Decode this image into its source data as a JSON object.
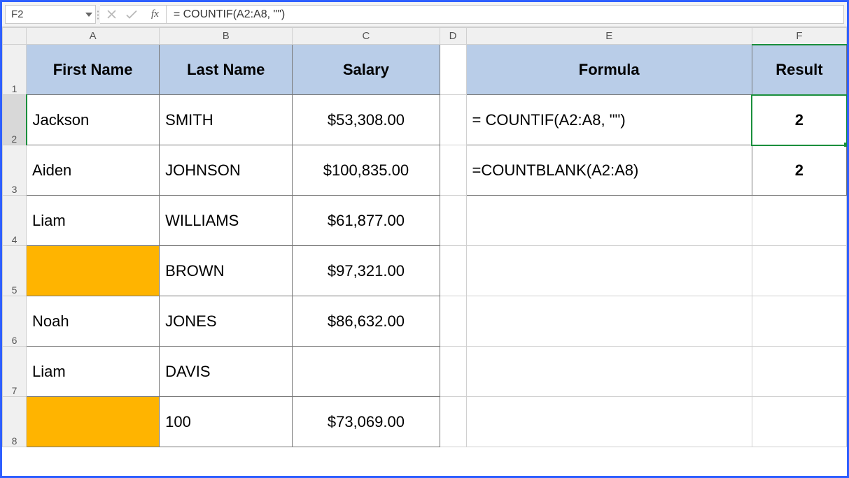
{
  "formula_bar": {
    "name_box": "F2",
    "fx_label": "fx",
    "formula": "= COUNTIF(A2:A8, \"\")"
  },
  "columns": [
    "A",
    "B",
    "C",
    "D",
    "E",
    "F"
  ],
  "row_numbers": [
    "1",
    "2",
    "3",
    "4",
    "5",
    "6",
    "7",
    "8"
  ],
  "selected_cell_ref": "F2",
  "headers": {
    "A": "First Name",
    "B": "Last Name",
    "C": "Salary",
    "E": "Formula",
    "F": "Result"
  },
  "data_rows": [
    {
      "first": "Jackson",
      "last": "SMITH",
      "salary": "$53,308.00",
      "first_blank_hl": false
    },
    {
      "first": "Aiden",
      "last": "JOHNSON",
      "salary": "$100,835.00",
      "first_blank_hl": false
    },
    {
      "first": "Liam",
      "last": "WILLIAMS",
      "salary": "$61,877.00",
      "first_blank_hl": false
    },
    {
      "first": "",
      "last": "BROWN",
      "salary": "$97,321.00",
      "first_blank_hl": true
    },
    {
      "first": "Noah",
      "last": "JONES",
      "salary": "$86,632.00",
      "first_blank_hl": false
    },
    {
      "first": "Liam",
      "last": "DAVIS",
      "salary": "",
      "first_blank_hl": false
    },
    {
      "first": "",
      "last": "100",
      "salary": "$73,069.00",
      "first_blank_hl": true
    }
  ],
  "side_rows": [
    {
      "formula": "= COUNTIF(A2:A8, \"\")",
      "result": "2"
    },
    {
      "formula": "=COUNTBLANK(A2:A8)",
      "result": "2"
    }
  ],
  "chart_data": {
    "type": "table",
    "title": "",
    "columns": [
      "First Name",
      "Last Name",
      "Salary"
    ],
    "rows": [
      [
        "Jackson",
        "SMITH",
        53308.0
      ],
      [
        "Aiden",
        "JOHNSON",
        100835.0
      ],
      [
        "Liam",
        "WILLIAMS",
        61877.0
      ],
      [
        "",
        "BROWN",
        97321.0
      ],
      [
        "Noah",
        "JONES",
        86632.0
      ],
      [
        "Liam",
        "DAVIS",
        null
      ],
      [
        "",
        "100",
        73069.0
      ]
    ],
    "side_table": {
      "columns": [
        "Formula",
        "Result"
      ],
      "rows": [
        [
          "= COUNTIF(A2:A8, \"\")",
          2
        ],
        [
          "=COUNTBLANK(A2:A8)",
          2
        ]
      ]
    }
  }
}
